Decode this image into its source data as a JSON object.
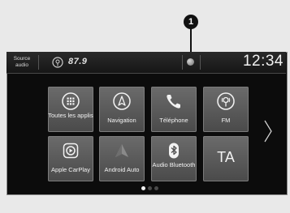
{
  "callout_number": "1",
  "status_bar": {
    "source_label": "Source audio",
    "station": "87.9",
    "clock": "12:34"
  },
  "tiles": [
    {
      "label": "Toutes les applis",
      "icon": "grid-apps-icon"
    },
    {
      "label": "Navigation",
      "icon": "compass-icon"
    },
    {
      "label": "Téléphone",
      "icon": "phone-icon"
    },
    {
      "label": "FM",
      "icon": "radio-icon"
    },
    {
      "label": "Apple CarPlay",
      "icon": "carplay-icon"
    },
    {
      "label": "Android Auto",
      "icon": "android-auto-icon"
    },
    {
      "label": "Audio Bluetooth",
      "icon": "bluetooth-icon"
    },
    {
      "label": "TA",
      "icon": ""
    }
  ],
  "pager": {
    "pages": 3,
    "current": 1
  },
  "colors": {
    "tile": "#5a5a5a",
    "screen": "#0c0c0c",
    "page": "#e9e9e9"
  }
}
